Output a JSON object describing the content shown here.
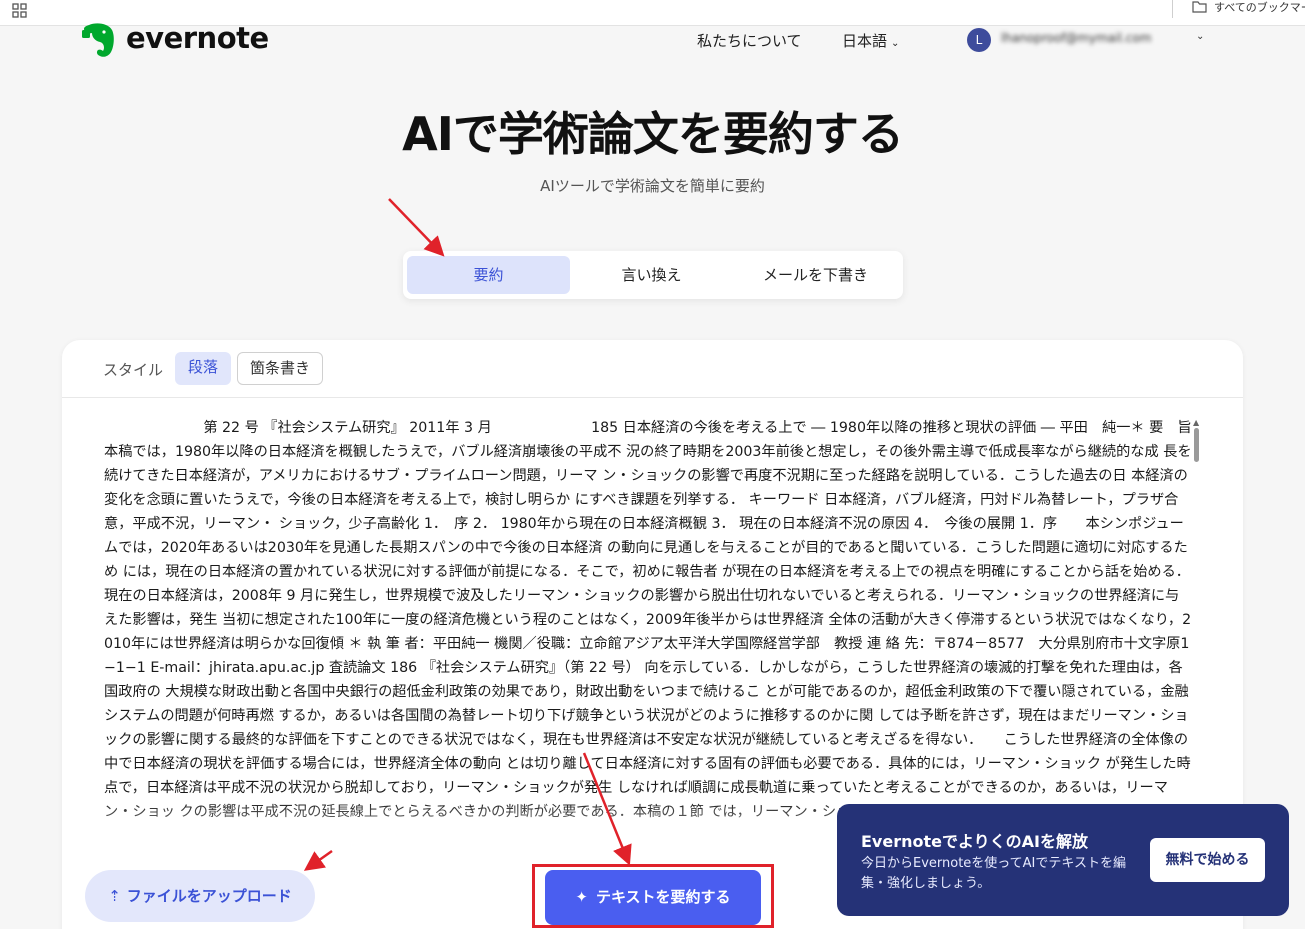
{
  "bookmarks": {
    "all_bookmarks_label": "すべてのブックマーク"
  },
  "header": {
    "logo_text": "evernote",
    "nav_about": "私たちについて",
    "nav_language": "日本語",
    "avatar_initial": "L",
    "account_email": "lhanoproof@mymail.com"
  },
  "hero": {
    "title": "AIで学術論文を要約する",
    "subtitle": "AIツールで学術論文を簡単に要約"
  },
  "mode_tabs": [
    {
      "label": "要約",
      "active": true
    },
    {
      "label": "言い換え",
      "active": false
    },
    {
      "label": "メールを下書き",
      "active": false
    }
  ],
  "style": {
    "label": "スタイル",
    "options": [
      {
        "label": "段落",
        "active": true
      },
      {
        "label": "箇条書き",
        "active": false
      }
    ]
  },
  "input_text": "　　　　　　　第 22 号 『社会システム研究』 2011年 3 月　　　　　　　185 日本経済の今後を考える上で ― 1980年以降の推移と現状の評価 ― 平田　純一＊ 要　旨　本稿では，1980年以降の日本経済を概観したうえで，バブル経済崩壊後の平成不 況の終了時期を2003年前後と想定し，その後外需主導で低成長率ながら継続的な成 長を続けてきた日本経済が，アメリカにおけるサブ・プライムローン問題，リーマ ン・ショックの影響で再度不況期に至った経路を説明している．こうした過去の日 本経済の変化を念頭に置いたうえで，今後の日本経済を考える上で，検討し明らか にすべき課題を列挙する． キーワード 日本経済，バブル経済，円対ドル為替レート，プラザ合意，平成不況，リーマン・ ショック，少子高齢化 1．　序 2． 1980年から現在の日本経済概観 3． 現在の日本経済不況の原因 4．　今後の展開 1．序　　本シンポジュームでは，2020年あるいは2030年を見通した長期スパンの中で今後の日本経済 の動向に見通しを与えることが目的であると聞いている．こうした問題に適切に対応するため には，現在の日本経済の置かれている状況に対する評価が前提になる．そこで，初めに報告者 が現在の日本経済を考える上での視点を明確にすることから話を始める．　　現在の日本経済は，2008年 9 月に発生し，世界規模で波及したリーマン・ショックの影響から脱出仕切れないでいると考えられる．リーマン・ショックの世界経済に与えた影響は，発生 当初に想定された100年に一度の経済危機という程のことはなく，2009年後半からは世界経済 全体の活動が大きく停滞するという状況ではなくなり，2010年には世界経済は明らかな回復傾 ＊ 執 筆 者：平田純一 機関／役職：立命館アジア太平洋大学国際経営学部　教授 連 絡 先：〒874－8577　大分県別府市十文字原1−1−1 E-mail：jhirata.apu.ac.jp 査読論文 186 『社会システム研究』（第 22 号） 向を示している．しかしながら，こうした世界経済の壊滅的打撃を免れた理由は，各国政府の 大規模な財政出動と各国中央銀行の超低金利政策の効果であり，財政出動をいつまで続けるこ とが可能であるのか，超低金利政策の下で覆い隠されている，金融システムの問題が何時再燃 するか，あるいは各国間の為替レート切り下げ競争という状況がどのように推移するのかに関 しては予断を許さず，現在はまだリーマン・ショックの影響に関する最終的な評価を下すことのできる状況ではなく，現在も世界経済は不安定な状況が継続していると考えざるを得ない．　　こうした世界経済の全体像の中で日本経済の現状を評価する場合には，世界経済全体の動向 とは切り離して日本経済に対する固有の評価も必要である．具体的には，リーマン・ショック が発生した時点で，日本経済は平成不況の状況から脱却しており，リーマン・ショックが発生 しなければ順調に成長軌道に乗っていたと考えることができるのか，あるいは，リーマン・ショッ クの影響は平成不況の延長線上でとらえるべきかの判断が必要である．本稿の１節 では，リーマン・ショック",
  "actions": {
    "upload_label": "ファイルをアップロード",
    "summarize_label": "テキストを要約する"
  },
  "promo": {
    "title": "EvernoteでよりくのAIを解放",
    "body": "今日からEvernoteを使ってAIでテキストを編集・強化しましょう。",
    "cta_label": "無料で始める"
  },
  "colors": {
    "accent": "#4a5ef0",
    "accent_soft": "#dde3fb",
    "promo_bg": "#253277",
    "annotation": "#e0222a",
    "logo_green": "#00a82d"
  }
}
